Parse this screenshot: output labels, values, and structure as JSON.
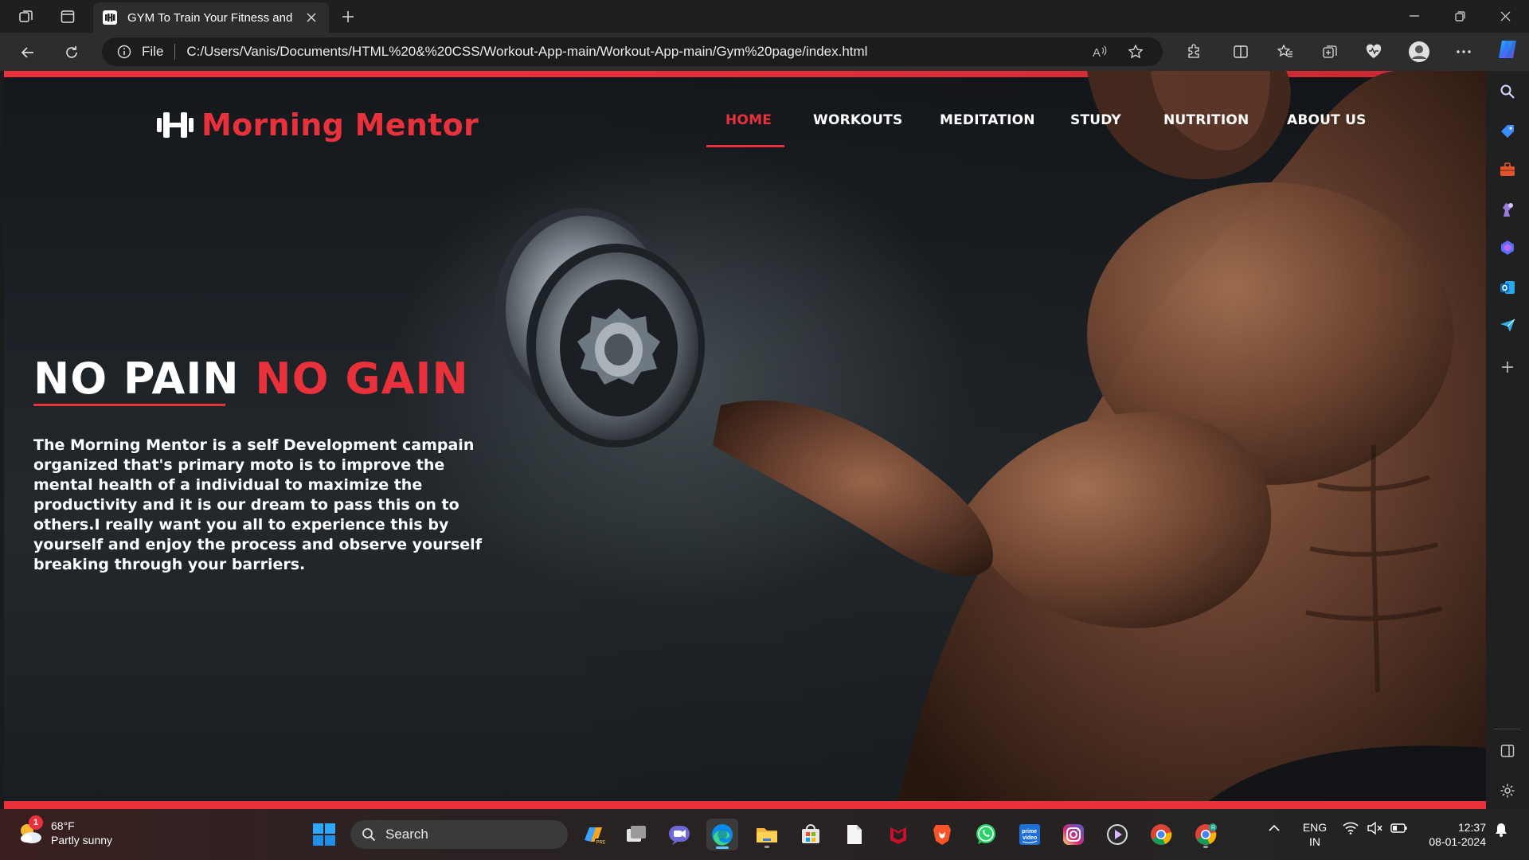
{
  "browser": {
    "tab_title": "GYM To Train Your Fitness and M",
    "omnibox_scheme": "File",
    "url": "C:/Users/Vanis/Documents/HTML%20&%20CSS/Workout-App-main/Workout-App-main/Gym%20page/index.html"
  },
  "site": {
    "logo_text": "Morning Mentor",
    "nav": [
      "HOME",
      "WORKOUTS",
      "MEDITATION",
      "STUDY",
      "NUTRITION",
      "ABOUT US"
    ],
    "active_nav": "HOME",
    "headline_white": "NO PAIN",
    "headline_red": "NO GAIN",
    "intro": "The Morning Mentor is a self Development campain organized that's primary moto is to improve the mental health of a individual to maximize the productivity and it is our dream to pass this on to others.I really want you all to experience this by yourself and enjoy the process and observe yourself breaking through your barriers.",
    "accent_color": "#e8313b"
  },
  "taskbar": {
    "weather_temp": "68°F",
    "weather_desc": "Partly sunny",
    "weather_badge": "1",
    "search_label": "Search",
    "lang_line1": "ENG",
    "lang_line2": "IN",
    "time": "12:37",
    "date": "08-01-2024"
  }
}
